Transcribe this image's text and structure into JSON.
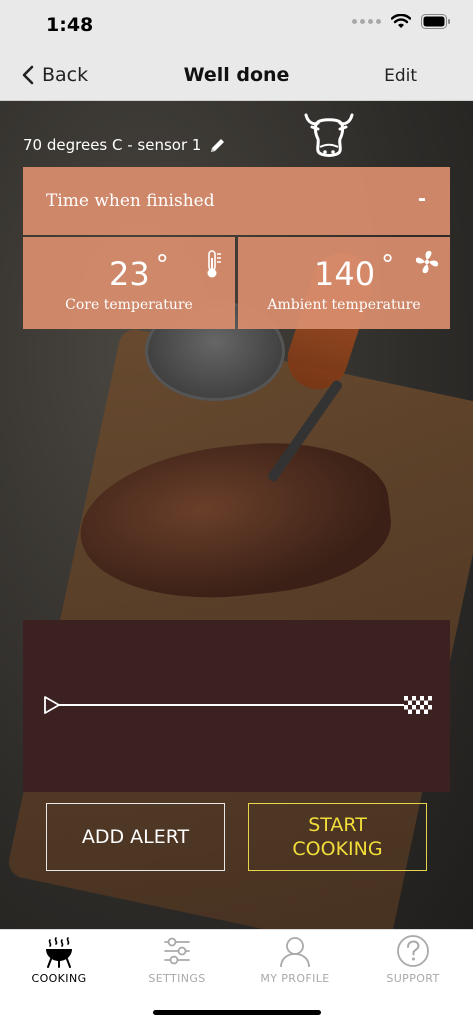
{
  "status_bar": {
    "time": "1:48"
  },
  "nav": {
    "back_label": "Back",
    "title": "Well done",
    "edit_label": "Edit"
  },
  "sensor": {
    "label": "70 degrees C - sensor 1",
    "animal_icon": "cow-icon",
    "edit_icon": "pencil-icon"
  },
  "finish": {
    "label": "Time when finished",
    "toggle": "-"
  },
  "temps": {
    "core": {
      "value": "23",
      "unit": "°",
      "caption": "Core temperature",
      "icon": "thermometer-icon"
    },
    "ambient": {
      "value": "140",
      "unit": "°",
      "caption": "Ambient temperature",
      "icon": "fan-icon"
    }
  },
  "progress": {
    "start_icon": "play-icon",
    "end_icon": "checkered-flag-icon"
  },
  "buttons": {
    "add_alert": "ADD ALERT",
    "start_cooking_line1": "START",
    "start_cooking_line2": "COOKING"
  },
  "tabs": [
    {
      "label": "COOKING",
      "icon": "grill-icon",
      "active": true
    },
    {
      "label": "SETTINGS",
      "icon": "sliders-icon",
      "active": false
    },
    {
      "label": "MY PROFILE",
      "icon": "person-icon",
      "active": false
    },
    {
      "label": "SUPPORT",
      "icon": "help-icon",
      "active": false
    }
  ],
  "colors": {
    "accent_tile": "#d88c6c",
    "progress_panel": "#3b2220",
    "start_button": "#f2de3a"
  }
}
